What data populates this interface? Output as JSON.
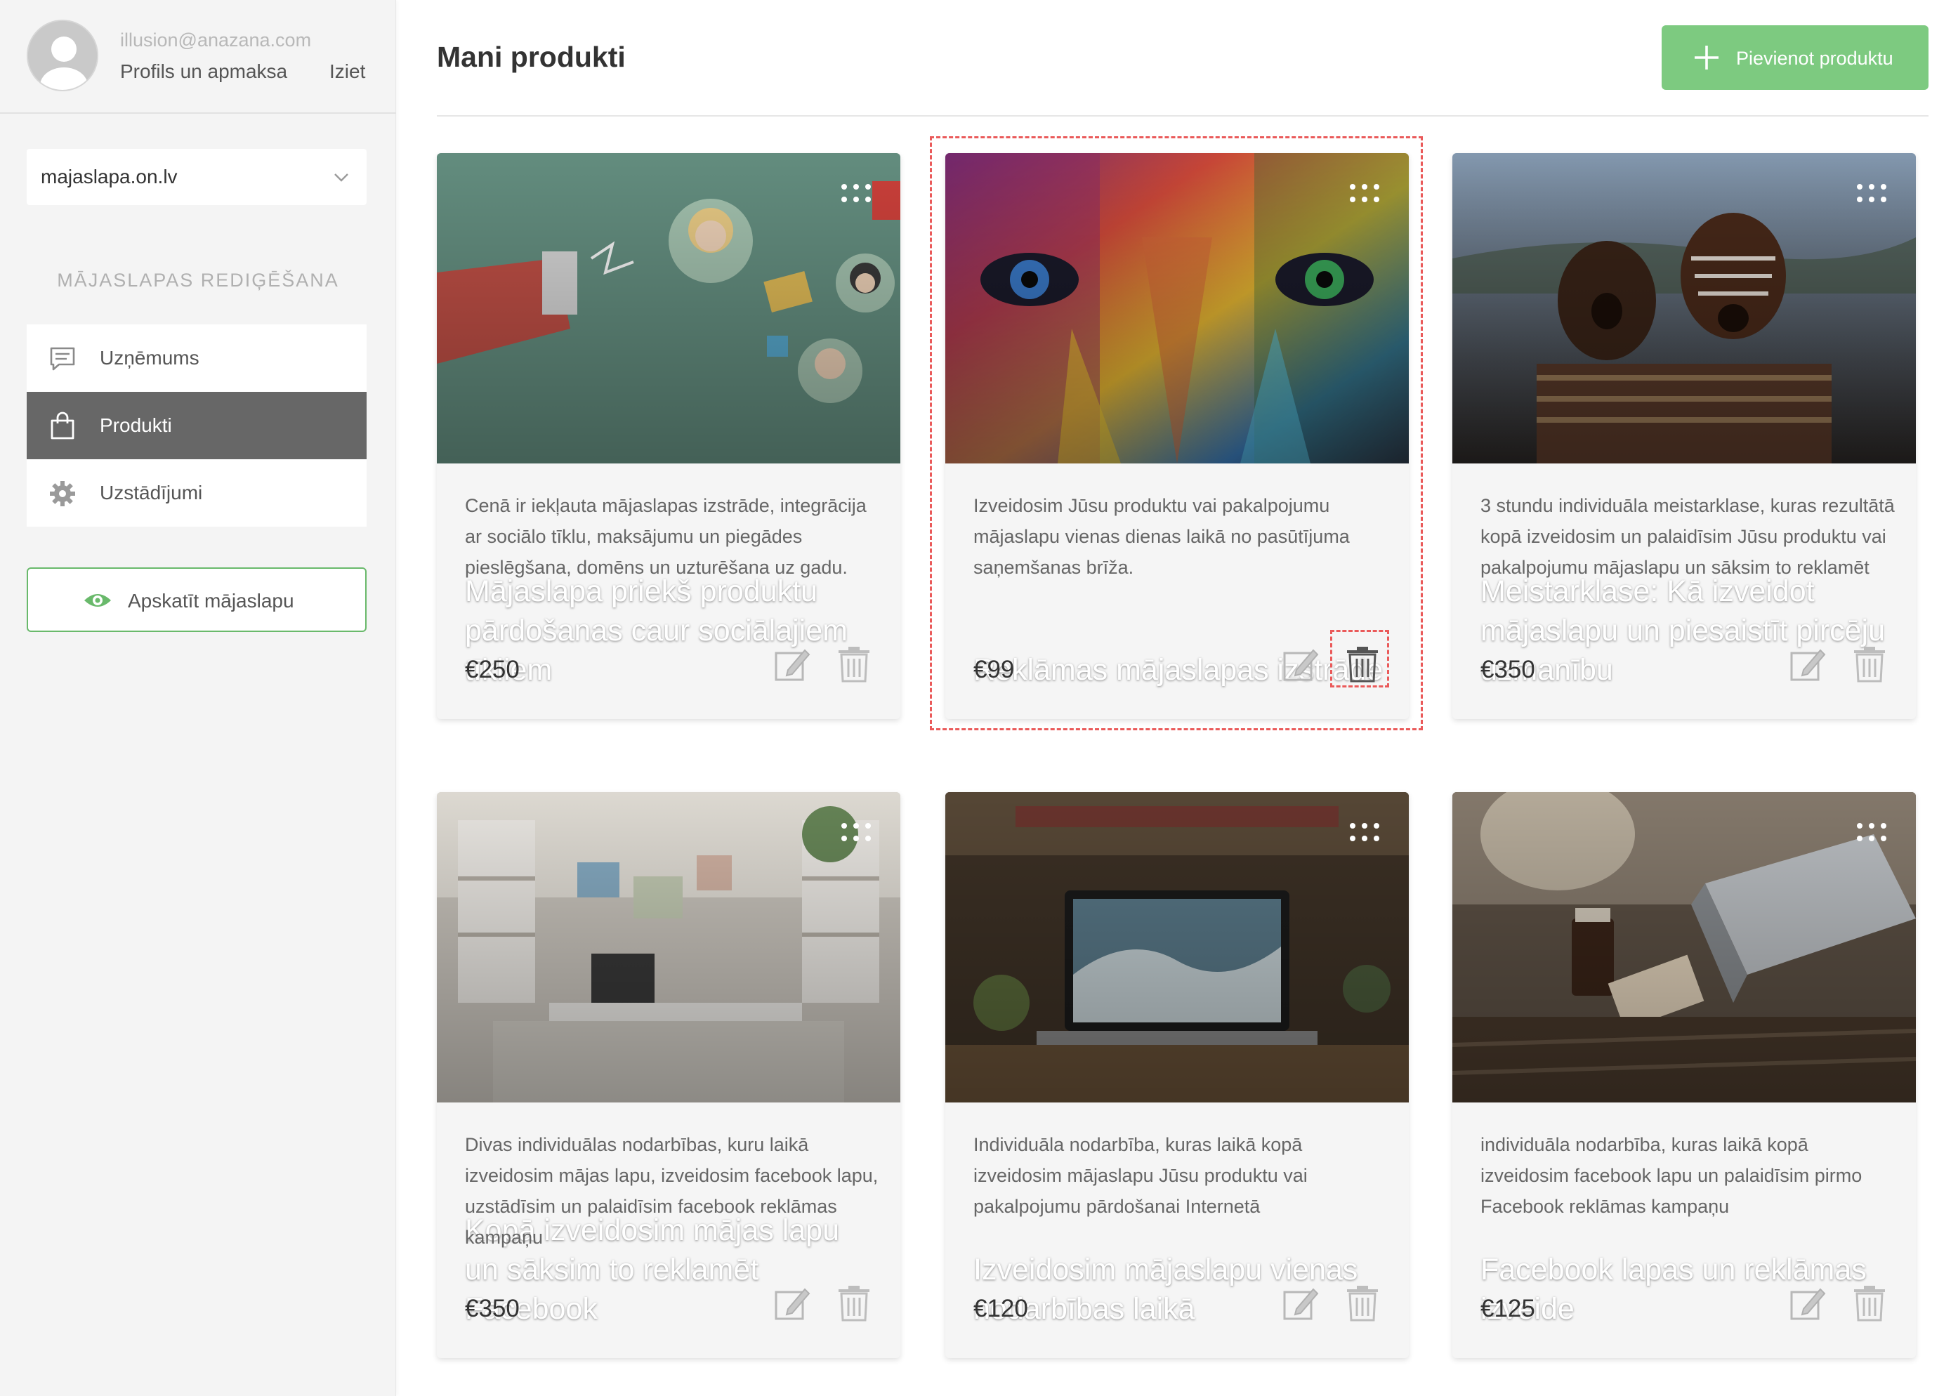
{
  "user": {
    "email": "illusion@anazana.com",
    "profile_link": "Profils un apmaksa",
    "logout_link": "Iziet"
  },
  "site_selector": {
    "value": "majaslapa.on.lv"
  },
  "sidebar": {
    "section_title": "MĀJASLAPAS REDIĢĒŠANA",
    "items": [
      {
        "label": "Uzņēmums",
        "icon": "chat-icon"
      },
      {
        "label": "Produkti",
        "icon": "bag-icon",
        "active": true
      },
      {
        "label": "Uzstādījumi",
        "icon": "gear-icon"
      }
    ],
    "view_site_label": "Apskatīt mājaslapu"
  },
  "header": {
    "title": "Mani produkti",
    "add_button_label": "Pievienot produktu"
  },
  "products": [
    {
      "title": "Mājaslapa priekš produktu pārdošanas caur sociālajiem tīkliem",
      "description": "Cenā ir iekļauta mājaslapas izstrāde, integrācija ar sociālo tīklu, maksājumu un piegādes pieslēgšana, domēns un uzturēšana uz gadu.",
      "price": "€250",
      "image": "illustration-social-media"
    },
    {
      "title": "Reklāmas mājaslapas izstrāde",
      "description": "Izveidosim Jūsu produktu vai pakalpojumu mājaslapu vienas dienas laikā no pasūtījuma saņemšanas brīža.",
      "price": "€99",
      "image": "painted-face-photo",
      "highlighted": true
    },
    {
      "title": "Meistarklase: Kā izveidot mājaslapu un piesaistīt pircēju uzmanību",
      "description": "3 stundu individuāla meistarklase, kuras rezultātā kopā izveidosim un palaidīsim Jūsu produktu vai pakalpojumu mājaslapu un sāksim to reklamēt",
      "price": "€350",
      "image": "painted-people-photo"
    },
    {
      "title": "Kopā izveidosim mājas lapu un sāksim to reklamēt Facebook",
      "description": "Divas individuālas nodarbības, kuru laikā izveidosim mājas lapu, izveidosim facebook lapu, uzstādīsim un palaidīsim facebook reklāmas kampaņu",
      "price": "€350",
      "image": "office-desk-photo"
    },
    {
      "title": "Izveidosim mājaslapu vienas nodarbības laikā",
      "description": "Individuāla nodarbība, kuras laikā kopā izveidosim mājaslapu Jūsu produktu vai pakalpojumu pārdošanai Internetā",
      "price": "€120",
      "image": "laptop-workspace-photo"
    },
    {
      "title": "Facebook lapas un reklāmas izveide",
      "description": "individuāla nodarbība, kuras laikā kopā izveidosim facebook lapu un palaidīsim pirmo Facebook reklāmas kampaņu",
      "price": "€125",
      "image": "cafe-laptop-photo"
    }
  ],
  "colors": {
    "accent_green": "#7dca80",
    "outline_green": "#69b96b",
    "active_menu": "#676767",
    "highlight_dashed": "#ea5a5a"
  }
}
